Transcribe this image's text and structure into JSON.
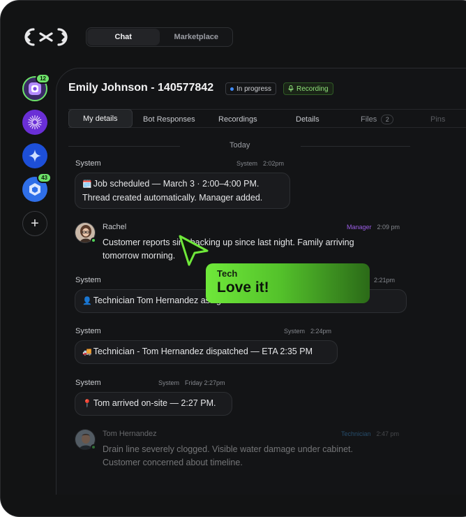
{
  "nav": {
    "tabs": [
      {
        "label": "Chat",
        "active": true
      },
      {
        "label": "Marketplace",
        "active": false
      }
    ]
  },
  "rail": {
    "items": [
      {
        "icon": "camera-app-icon",
        "badge": "12",
        "color": "#8a5cf6"
      },
      {
        "icon": "starburst-app-icon",
        "badge": "",
        "color": "#7c3aed"
      },
      {
        "icon": "sparkle-app-icon",
        "badge": "",
        "color": "#2563eb"
      },
      {
        "icon": "hexagon-app-icon",
        "badge": "43",
        "color": "#3b82f6"
      }
    ],
    "add_label": "+"
  },
  "header": {
    "title": "Emily Johnson - 140577842",
    "status_progress": "In progress",
    "status_recording": "Recording"
  },
  "tabs": [
    {
      "label": "My details",
      "active": true
    },
    {
      "label": "Bot Responses"
    },
    {
      "label": "Recordings"
    },
    {
      "label": "Details"
    },
    {
      "label": "Files",
      "count": "2"
    },
    {
      "label": "Pins"
    }
  ],
  "day_label": "Today",
  "messages": [
    {
      "sender": "System",
      "role": "System",
      "time": "2:02pm",
      "emoji": "🗓️",
      "line1": "Job scheduled — March 3 · 2:00–4:00 PM.",
      "line2": "Thread created automatically. Manager added."
    },
    {
      "sender": "Rachel",
      "role": "Manager",
      "time": "2:09 pm",
      "line1": "Customer reports sink backing up since last night. Family arriving",
      "line2": "tomorrow morning."
    },
    {
      "sender": "System",
      "role": "System",
      "time": "2:21pm",
      "emoji": "👤",
      "line1": "Technician Tom Hernandez assigned and added to the channel."
    },
    {
      "sender": "System",
      "role": "System",
      "time": "2:24pm",
      "emoji": "🚚",
      "line1": "Technician - Tom Hernandez dispatched — ETA 2:35 PM"
    },
    {
      "sender": "System",
      "role": "System",
      "time": "Friday 2:27pm",
      "emoji": "📍",
      "line1": "Tom arrived on-site — 2:27 PM."
    },
    {
      "sender": "Tom Hernandez",
      "role": "Technician",
      "time": "2:47 pm",
      "line1": "Drain line severely clogged. Visible water damage under cabinet.",
      "line2": "Customer concerned about timeline."
    }
  ],
  "tooltip": {
    "name": "Tech",
    "message": "Love it!"
  },
  "colors": {
    "accent_green": "#6ee26a",
    "manager": "#9b5de5",
    "technician": "#2f7fbf",
    "online": "#52d45a"
  }
}
